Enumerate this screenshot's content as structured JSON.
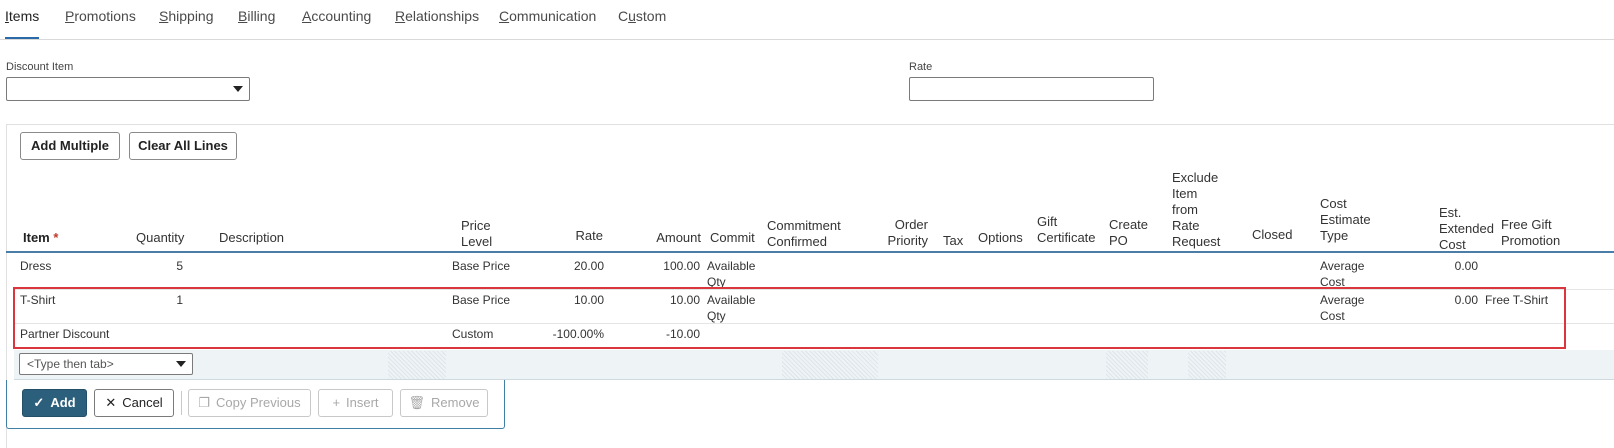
{
  "tabs": [
    {
      "pre": "",
      "u": "I",
      "post": "tems"
    },
    {
      "pre": "",
      "u": "P",
      "post": "romotions"
    },
    {
      "pre": "",
      "u": "S",
      "post": "hipping"
    },
    {
      "pre": "",
      "u": "B",
      "post": "illing"
    },
    {
      "pre": "",
      "u": "A",
      "post": "ccounting"
    },
    {
      "pre": "",
      "u": "R",
      "post": "elationships"
    },
    {
      "pre": "",
      "u": "C",
      "post": "ommunication"
    },
    {
      "pre": "C",
      "u": "u",
      "post": "stom"
    }
  ],
  "fields": {
    "discount_item_label": "Discount Item",
    "discount_item_value": "",
    "rate_label": "Rate",
    "rate_value": ""
  },
  "toolbar": {
    "add_multiple": "Add Multiple",
    "clear_all_lines": "Clear All Lines"
  },
  "columns": {
    "item": "Item",
    "item_required": "*",
    "quantity": "Quantity",
    "description": "Description",
    "price_level_1": "Price",
    "price_level_2": "Level",
    "rate": "Rate",
    "amount": "Amount",
    "commit": "Commit",
    "commitment_1": "Commitment",
    "commitment_2": "Confirmed",
    "order_priority_1": "Order",
    "order_priority_2": "Priority",
    "tax": "Tax",
    "options": "Options",
    "gift_cert_1": "Gift",
    "gift_cert_2": "Certificate",
    "create_po_1": "Create",
    "create_po_2": "PO",
    "exclude_1": "Exclude",
    "exclude_2": "Item",
    "exclude_3": "from",
    "exclude_4": "Rate",
    "exclude_5": "Request",
    "closed": "Closed",
    "cost_est_1": "Cost",
    "cost_est_2": "Estimate",
    "cost_est_3": "Type",
    "est_ext_1": "Est.",
    "est_ext_2": "Extended",
    "est_ext_3": "Cost",
    "free_gift_1": "Free Gift",
    "free_gift_2": "Promotion"
  },
  "rows": [
    {
      "item": "Dress",
      "quantity": "5",
      "price_level": "Base Price",
      "rate": "20.00",
      "amount": "100.00",
      "commit_1": "Available",
      "commit_2": "Qty",
      "cost_type_1": "Average",
      "cost_type_2": "Cost",
      "est_cost": "0.00",
      "free_gift": ""
    },
    {
      "item": "T-Shirt",
      "quantity": "1",
      "price_level": "Base Price",
      "rate": "10.00",
      "amount": "10.00",
      "commit_1": "Available",
      "commit_2": "Qty",
      "cost_type_1": "Average",
      "cost_type_2": "Cost",
      "est_cost": "0.00",
      "free_gift": "Free T-Shirt"
    },
    {
      "item": "Partner Discount",
      "quantity": "",
      "price_level": "Custom",
      "rate": "-100.00%",
      "amount": "-10.00",
      "commit_1": "",
      "commit_2": "",
      "cost_type_1": "",
      "cost_type_2": "",
      "est_cost": "",
      "free_gift": ""
    }
  ],
  "entry": {
    "placeholder": "<Type then tab>"
  },
  "actions": {
    "add": "Add",
    "cancel": "Cancel",
    "copy_previous": "Copy Previous",
    "insert": "Insert",
    "remove": "Remove"
  },
  "colors": {
    "accent": "#2c5f7c",
    "highlight": "#d9363e",
    "tab_underline": "#2a6aa8"
  }
}
